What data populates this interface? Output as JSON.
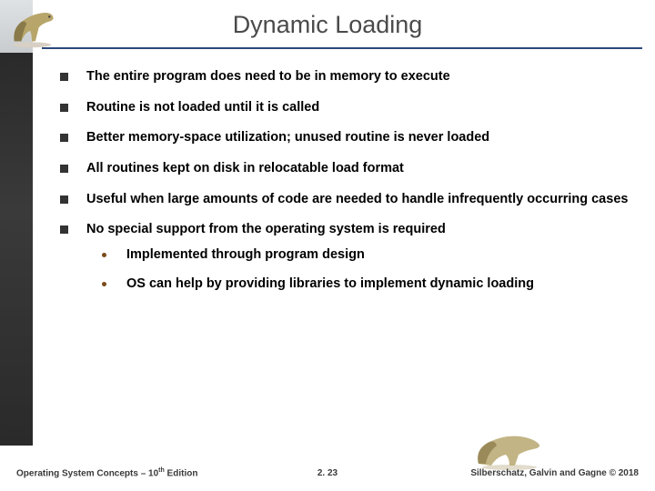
{
  "title": "Dynamic Loading",
  "bullets": [
    "The entire  program does need to be in memory to execute",
    "Routine is not loaded until it is called",
    "Better memory-space utilization; unused routine is never loaded",
    "All routines kept on disk in relocatable load format",
    "Useful when large amounts of code are needed to handle infrequently occurring cases",
    "No special support from the operating system is required"
  ],
  "subbullets": [
    "Implemented through program design",
    "OS can help by providing libraries to implement dynamic loading"
  ],
  "footer": {
    "left_prefix": "Operating System Concepts – 10",
    "left_suffix": " Edition",
    "th": "th",
    "center": "2. 23",
    "right": "Silberschatz, Galvin and Gagne © 2018"
  }
}
